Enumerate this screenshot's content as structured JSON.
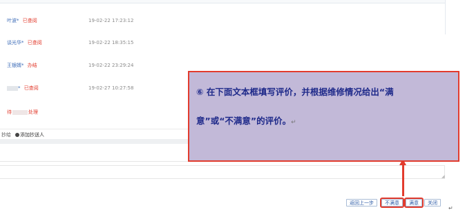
{
  "records": [
    {
      "name": "叶波",
      "suffix": "*",
      "status": "已查阅",
      "time": "19-02-22 17:23:12"
    },
    {
      "name": "谈光华",
      "suffix": "*",
      "status": "已查阅",
      "time": "19-02-22 18:35:15"
    },
    {
      "name": "王银婿",
      "suffix": "*",
      "status": "办结",
      "time": "19-02-22 23:29:24"
    },
    {
      "name": "",
      "suffix": "*",
      "status": "已查阅",
      "time": "19-02-27 10:27:58"
    }
  ],
  "pending": {
    "prefix": "待",
    "status": "处理"
  },
  "cc": {
    "label": "抄给",
    "add_label": "添加抄送人"
  },
  "callout": {
    "line1": "⑥ 在下面文本框填写评价，并根据维修情况给出“满",
    "line2": "意”或“不满意”的评价。",
    "return_mark": "↵"
  },
  "buttons": {
    "back": "返回上一步",
    "unsatisfied": "不满意",
    "satisfied": "满意",
    "close": "关闭"
  },
  "colors": {
    "accent_red": "#e23b2d",
    "link_blue": "#3a6ab7",
    "callout_bg": "#c2b9d8",
    "callout_text": "#1f2a8a"
  }
}
